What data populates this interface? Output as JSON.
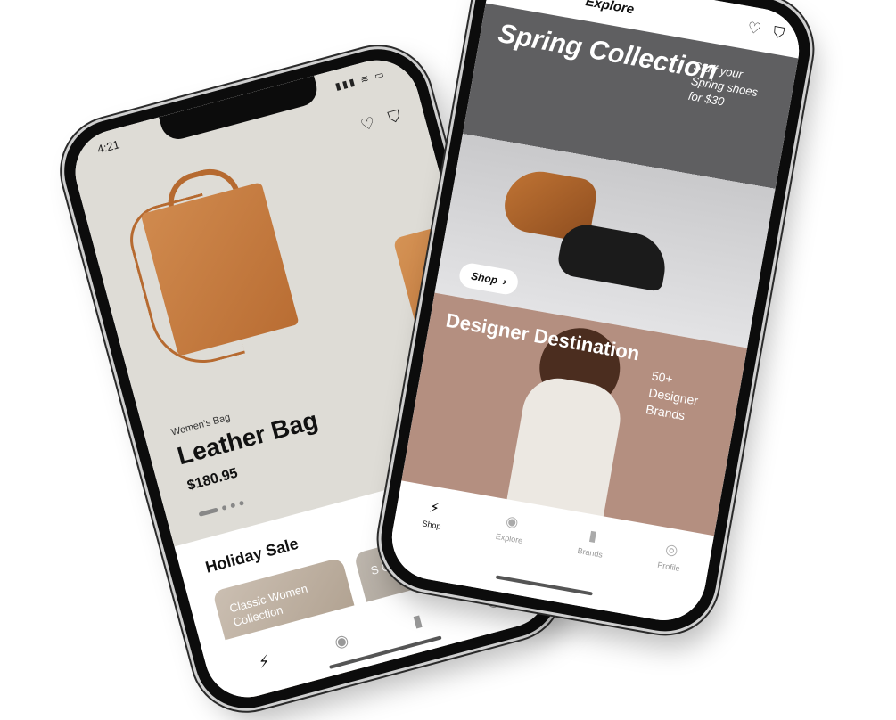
{
  "left_phone": {
    "status": {
      "time": "4:21",
      "icons": "▮▮▮ ≋ ▭"
    },
    "header_icons": {
      "heart": "♡",
      "bag": "⛉"
    },
    "product": {
      "category": "Women's Bag",
      "name": "Leather Bag",
      "price": "$180.95",
      "carousel_pages": 4,
      "active_page": 1
    },
    "section": {
      "title": "Holiday Sale"
    },
    "cards": [
      {
        "label": "Classic Women Collection"
      },
      {
        "label": "S C"
      }
    ],
    "nav": [
      {
        "icon": "lightning-icon",
        "glyph": "⚡",
        "active": true
      },
      {
        "icon": "explore-icon",
        "glyph": "◉",
        "active": false
      },
      {
        "icon": "bookmark-icon",
        "glyph": "▮",
        "active": false
      },
      {
        "icon": "profile-icon",
        "glyph": "◎",
        "active": false
      }
    ]
  },
  "right_phone": {
    "topbar": {
      "title": "Explore",
      "heart": "♡",
      "bag": "⛉"
    },
    "spring": {
      "title": "Spring Collection",
      "subtitle": "Stuff your Spring shoes for $30",
      "button_label": "Shop",
      "button_chevron": "›"
    },
    "designer": {
      "title": "Designer Destination",
      "subtitle": "50+ Designer Brands"
    },
    "nav": [
      {
        "icon": "lightning-icon",
        "glyph": "⚡",
        "label": "Shop",
        "active": true
      },
      {
        "icon": "explore-icon",
        "glyph": "◉",
        "label": "Explore",
        "active": false
      },
      {
        "icon": "bookmark-icon",
        "glyph": "▮",
        "label": "Brands",
        "active": false
      },
      {
        "icon": "profile-icon",
        "glyph": "◎",
        "label": "Profile",
        "active": false
      }
    ]
  },
  "colors": {
    "left_hero_bg": "#dedcd6",
    "spring_dark": "#5f5f61",
    "designer_bg": "#b48f80",
    "accent": "#111111"
  }
}
